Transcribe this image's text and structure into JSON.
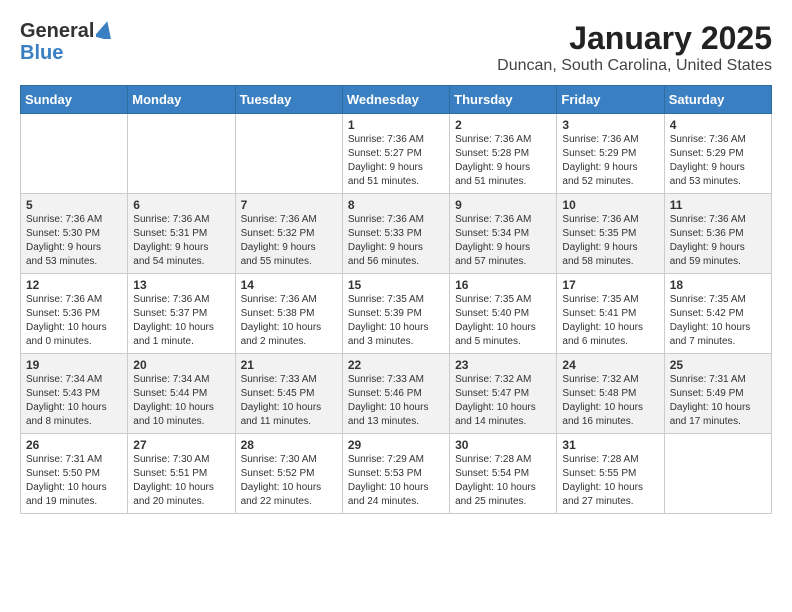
{
  "header": {
    "logo_line1": "General",
    "logo_line2": "Blue",
    "title": "January 2025",
    "subtitle": "Duncan, South Carolina, United States"
  },
  "calendar": {
    "days_of_week": [
      "Sunday",
      "Monday",
      "Tuesday",
      "Wednesday",
      "Thursday",
      "Friday",
      "Saturday"
    ],
    "weeks": [
      [
        {
          "day": "",
          "info": ""
        },
        {
          "day": "",
          "info": ""
        },
        {
          "day": "",
          "info": ""
        },
        {
          "day": "1",
          "info": "Sunrise: 7:36 AM\nSunset: 5:27 PM\nDaylight: 9 hours\nand 51 minutes."
        },
        {
          "day": "2",
          "info": "Sunrise: 7:36 AM\nSunset: 5:28 PM\nDaylight: 9 hours\nand 51 minutes."
        },
        {
          "day": "3",
          "info": "Sunrise: 7:36 AM\nSunset: 5:29 PM\nDaylight: 9 hours\nand 52 minutes."
        },
        {
          "day": "4",
          "info": "Sunrise: 7:36 AM\nSunset: 5:29 PM\nDaylight: 9 hours\nand 53 minutes."
        }
      ],
      [
        {
          "day": "5",
          "info": "Sunrise: 7:36 AM\nSunset: 5:30 PM\nDaylight: 9 hours\nand 53 minutes."
        },
        {
          "day": "6",
          "info": "Sunrise: 7:36 AM\nSunset: 5:31 PM\nDaylight: 9 hours\nand 54 minutes."
        },
        {
          "day": "7",
          "info": "Sunrise: 7:36 AM\nSunset: 5:32 PM\nDaylight: 9 hours\nand 55 minutes."
        },
        {
          "day": "8",
          "info": "Sunrise: 7:36 AM\nSunset: 5:33 PM\nDaylight: 9 hours\nand 56 minutes."
        },
        {
          "day": "9",
          "info": "Sunrise: 7:36 AM\nSunset: 5:34 PM\nDaylight: 9 hours\nand 57 minutes."
        },
        {
          "day": "10",
          "info": "Sunrise: 7:36 AM\nSunset: 5:35 PM\nDaylight: 9 hours\nand 58 minutes."
        },
        {
          "day": "11",
          "info": "Sunrise: 7:36 AM\nSunset: 5:36 PM\nDaylight: 9 hours\nand 59 minutes."
        }
      ],
      [
        {
          "day": "12",
          "info": "Sunrise: 7:36 AM\nSunset: 5:36 PM\nDaylight: 10 hours\nand 0 minutes."
        },
        {
          "day": "13",
          "info": "Sunrise: 7:36 AM\nSunset: 5:37 PM\nDaylight: 10 hours\nand 1 minute."
        },
        {
          "day": "14",
          "info": "Sunrise: 7:36 AM\nSunset: 5:38 PM\nDaylight: 10 hours\nand 2 minutes."
        },
        {
          "day": "15",
          "info": "Sunrise: 7:35 AM\nSunset: 5:39 PM\nDaylight: 10 hours\nand 3 minutes."
        },
        {
          "day": "16",
          "info": "Sunrise: 7:35 AM\nSunset: 5:40 PM\nDaylight: 10 hours\nand 5 minutes."
        },
        {
          "day": "17",
          "info": "Sunrise: 7:35 AM\nSunset: 5:41 PM\nDaylight: 10 hours\nand 6 minutes."
        },
        {
          "day": "18",
          "info": "Sunrise: 7:35 AM\nSunset: 5:42 PM\nDaylight: 10 hours\nand 7 minutes."
        }
      ],
      [
        {
          "day": "19",
          "info": "Sunrise: 7:34 AM\nSunset: 5:43 PM\nDaylight: 10 hours\nand 8 minutes."
        },
        {
          "day": "20",
          "info": "Sunrise: 7:34 AM\nSunset: 5:44 PM\nDaylight: 10 hours\nand 10 minutes."
        },
        {
          "day": "21",
          "info": "Sunrise: 7:33 AM\nSunset: 5:45 PM\nDaylight: 10 hours\nand 11 minutes."
        },
        {
          "day": "22",
          "info": "Sunrise: 7:33 AM\nSunset: 5:46 PM\nDaylight: 10 hours\nand 13 minutes."
        },
        {
          "day": "23",
          "info": "Sunrise: 7:32 AM\nSunset: 5:47 PM\nDaylight: 10 hours\nand 14 minutes."
        },
        {
          "day": "24",
          "info": "Sunrise: 7:32 AM\nSunset: 5:48 PM\nDaylight: 10 hours\nand 16 minutes."
        },
        {
          "day": "25",
          "info": "Sunrise: 7:31 AM\nSunset: 5:49 PM\nDaylight: 10 hours\nand 17 minutes."
        }
      ],
      [
        {
          "day": "26",
          "info": "Sunrise: 7:31 AM\nSunset: 5:50 PM\nDaylight: 10 hours\nand 19 minutes."
        },
        {
          "day": "27",
          "info": "Sunrise: 7:30 AM\nSunset: 5:51 PM\nDaylight: 10 hours\nand 20 minutes."
        },
        {
          "day": "28",
          "info": "Sunrise: 7:30 AM\nSunset: 5:52 PM\nDaylight: 10 hours\nand 22 minutes."
        },
        {
          "day": "29",
          "info": "Sunrise: 7:29 AM\nSunset: 5:53 PM\nDaylight: 10 hours\nand 24 minutes."
        },
        {
          "day": "30",
          "info": "Sunrise: 7:28 AM\nSunset: 5:54 PM\nDaylight: 10 hours\nand 25 minutes."
        },
        {
          "day": "31",
          "info": "Sunrise: 7:28 AM\nSunset: 5:55 PM\nDaylight: 10 hours\nand 27 minutes."
        },
        {
          "day": "",
          "info": ""
        }
      ]
    ]
  }
}
